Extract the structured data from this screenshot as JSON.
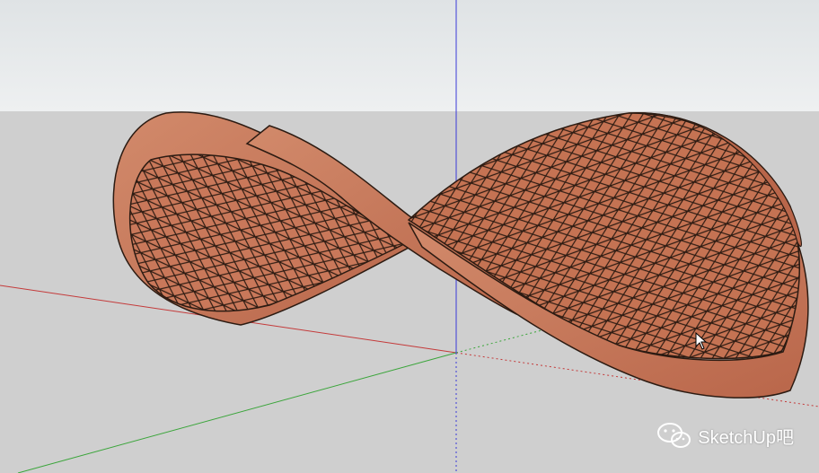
{
  "watermark": {
    "text": "SketchUp吧",
    "icon": "wechat-icon"
  },
  "scene": {
    "material_color": "#c9785a",
    "sky_color": "#e6e9ea",
    "ground_color": "#cfcfcf",
    "axis_colors": {
      "red": "#c43a3a",
      "green": "#3aa53a",
      "blue": "#3a3ad8"
    }
  }
}
